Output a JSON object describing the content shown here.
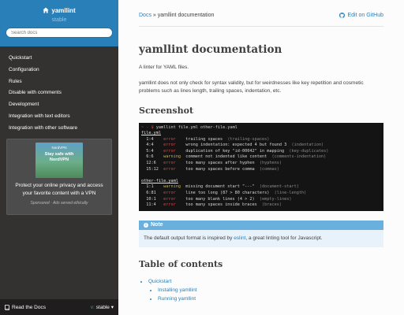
{
  "sidebar": {
    "brand": "yamllint",
    "version": "stable",
    "search_placeholder": "Search docs",
    "nav": [
      {
        "label": "Quickstart"
      },
      {
        "label": "Configuration"
      },
      {
        "label": "Rules"
      },
      {
        "label": "Disable with comments"
      },
      {
        "label": "Development"
      },
      {
        "label": "Integration with text editors"
      },
      {
        "label": "Integration with other software"
      }
    ],
    "ad": {
      "logo": "NordVPN",
      "headline": "Stay safe with NordVPN",
      "text": "Protect your online privacy and access your favorite content with a VPN",
      "sponsor": "Sponsored · Ads served ethically"
    },
    "footer": {
      "label": "Read the Docs",
      "version_prefix": "v:",
      "version": "stable",
      "caret": "▾"
    }
  },
  "breadcrumbs": {
    "home": "Docs",
    "separator": "»",
    "current": "yamllint documentation",
    "edit_label": "Edit on GitHub"
  },
  "page": {
    "title": "yamllint documentation",
    "intro": "A linter for YAML files.",
    "description": "yamllint does not only check for syntax validity, but for weirdnesses like key repetition and cosmetic problems such as lines length, trailing spaces, indentation, etc.",
    "screenshot_heading": "Screenshot",
    "terminal": {
      "prompt": "~ - $",
      "command": "yamllint file.yml other-file.yaml",
      "files": [
        {
          "name": "file.yml",
          "lines": [
            {
              "pos": "1:4",
              "level": "error",
              "msg": "trailing spaces",
              "rule": "(trailing-spaces)"
            },
            {
              "pos": "4:4",
              "level": "error",
              "msg": "wrong indentation: expected 4 but found 3",
              "rule": "(indentation)"
            },
            {
              "pos": "5:4",
              "level": "error",
              "msg": "duplication of key \"id-00042\" in mapping",
              "rule": "(key-duplicates)"
            },
            {
              "pos": "6:6",
              "level": "warning",
              "msg": "comment not indented like content",
              "rule": "(comments-indentation)"
            },
            {
              "pos": "12:6",
              "level": "error",
              "msg": "too many spaces after hyphen",
              "rule": "(hyphens)"
            },
            {
              "pos": "15:12",
              "level": "error",
              "msg": "too many spaces before comma",
              "rule": "(commas)"
            }
          ]
        },
        {
          "name": "other-file.yaml",
          "lines": [
            {
              "pos": "1:1",
              "level": "warning",
              "msg": "missing document start \"---\"",
              "rule": "(document-start)"
            },
            {
              "pos": "6:81",
              "level": "error",
              "msg": "line too long (87 > 80 characters)",
              "rule": "(line-length)"
            },
            {
              "pos": "10:1",
              "level": "error",
              "msg": "too many blank lines (4 > 2)",
              "rule": "(empty-lines)"
            },
            {
              "pos": "11:4",
              "level": "error",
              "msg": "too many spaces inside braces",
              "rule": "(braces)"
            }
          ]
        }
      ]
    },
    "note": {
      "title": "Note",
      "text_before": "The default output format is inspired by ",
      "link": "eslint",
      "text_after": ", a great linting tool for Javascript."
    },
    "toc_heading": "Table of contents",
    "toc": {
      "quickstart": "Quickstart",
      "sub": [
        "Installing yamllint",
        "Running yamllint"
      ]
    }
  },
  "colors": {
    "sidebar_bg": "#343131",
    "sidebar_top": "#2980b9",
    "link": "#2980b9",
    "note_header": "#6ab0de",
    "note_bg": "#e7f2fa",
    "error": "#d14b4b",
    "warning": "#c9b437"
  }
}
